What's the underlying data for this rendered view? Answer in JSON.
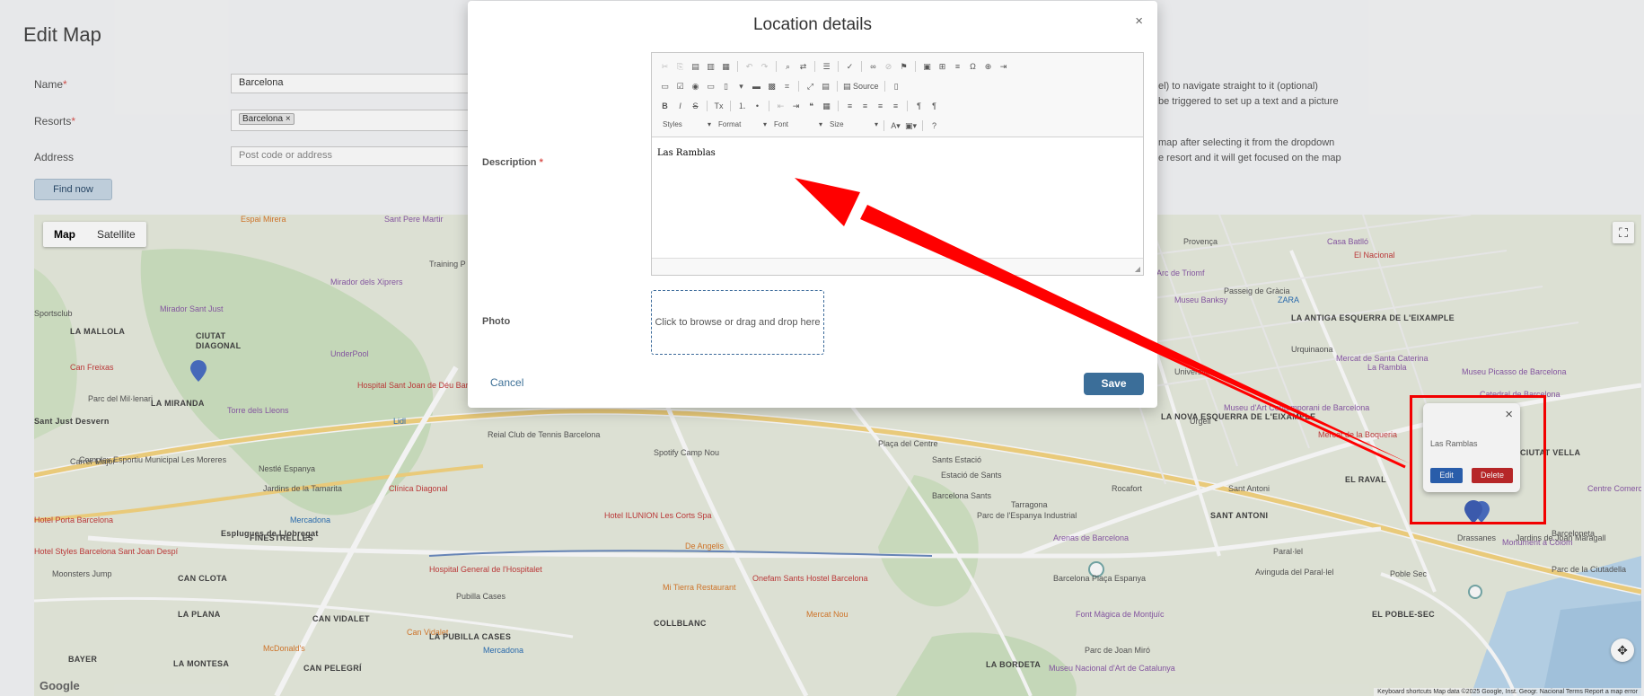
{
  "page": {
    "title": "Edit Map",
    "find_now": "Find now"
  },
  "form": {
    "name_label": "Name",
    "name_value": "Barcelona",
    "resorts_label": "Resorts",
    "resort_tag": "Barcelona",
    "resort_tag_remove": "×",
    "address_label": "Address",
    "address_placeholder": "Post code or address",
    "required_mark": "*"
  },
  "help": {
    "line1": "el) to navigate straight to it (optional)",
    "line2": "be triggered to set up a text and a picture",
    "line3": "map after selecting it from the dropdown",
    "line4": "e resort and it will get focused on the map"
  },
  "map": {
    "map_tab": "Map",
    "satellite_tab": "Satellite",
    "google": "Google",
    "attribution": "Keyboard shortcuts   Map data ©2025 Google, Inst. Geogr. Nacional   Terms   Report a map error",
    "labels": [
      {
        "text": "Espai Mirera",
        "c": "orange"
      },
      {
        "text": "Sant Pere Martir",
        "c": "poi"
      },
      {
        "text": "Mirador dels Xiprers",
        "c": "poi"
      },
      {
        "text": "Training P",
        "c": ""
      },
      {
        "text": "Mirador Sant Just",
        "c": "poi"
      },
      {
        "text": "CIUTAT",
        "c": "b"
      },
      {
        "text": "DIAGONAL",
        "c": "b"
      },
      {
        "text": "LA MALLOLA",
        "c": "b"
      },
      {
        "text": "Sportsclub",
        "c": ""
      },
      {
        "text": "UnderPool",
        "c": "poi"
      },
      {
        "text": "Can Freixas",
        "c": "red"
      },
      {
        "text": "Hospital Sant Joan de Déu Barcelona",
        "c": "red"
      },
      {
        "text": "LA MIRANDA",
        "c": "b"
      },
      {
        "text": "Torre dels Lleons",
        "c": "poi"
      },
      {
        "text": "Parc del Mil·lenari",
        "c": ""
      },
      {
        "text": "Sant Just Desvern",
        "c": "b"
      },
      {
        "text": "Lidl",
        "c": "blue"
      },
      {
        "text": "Carrer Major",
        "c": ""
      },
      {
        "text": "Complex Esportiu Municipal Les Moreres",
        "c": ""
      },
      {
        "text": "Nestlé Espanya",
        "c": ""
      },
      {
        "text": "Jardins de la Tamarita",
        "c": ""
      },
      {
        "text": "Clínica Diagonal",
        "c": "red"
      },
      {
        "text": "Mercadona",
        "c": "blue"
      },
      {
        "text": "Hotel Porta Barcelona",
        "c": "red"
      },
      {
        "text": "Esplugues de Llobregat",
        "c": "b"
      },
      {
        "text": "FINESTRELLES",
        "c": "b"
      },
      {
        "text": "Hotel Styles Barcelona Sant Joan Despí",
        "c": "red"
      },
      {
        "text": "Moonsters Jump",
        "c": ""
      },
      {
        "text": "CAN CLOTA",
        "c": "b"
      },
      {
        "text": "Hospital General de l'Hospitalet",
        "c": "red"
      },
      {
        "text": "LA PLANA",
        "c": "b"
      },
      {
        "text": "CAN VIDALET",
        "c": "b"
      },
      {
        "text": "Can Vidalet",
        "c": "orange"
      },
      {
        "text": "Pubilla Cases",
        "c": ""
      },
      {
        "text": "LA PUBILLA CASES",
        "c": "b"
      },
      {
        "text": "BAYER",
        "c": "b"
      },
      {
        "text": "LA MONTESA",
        "c": "b"
      },
      {
        "text": "McDonald's",
        "c": "orange"
      },
      {
        "text": "CAN PELEGRÍ",
        "c": "b"
      },
      {
        "text": "Mercadona",
        "c": "blue"
      },
      {
        "text": "Reial Club de Tennis Barcelona",
        "c": ""
      },
      {
        "text": "Hotel ILUNION Les Corts Spa",
        "c": "red"
      },
      {
        "text": "De Angelis",
        "c": "orange"
      },
      {
        "text": "Spotify Camp Nou",
        "c": ""
      },
      {
        "text": "Mi Tierra Restaurant",
        "c": "orange"
      },
      {
        "text": "Onefam Sants Hostel Barcelona",
        "c": "red"
      },
      {
        "text": "COLLBLANC",
        "c": "b"
      },
      {
        "text": "Mercat Nou",
        "c": "orange"
      },
      {
        "text": "Plaça del Centre",
        "c": ""
      },
      {
        "text": "Sants Estació",
        "c": ""
      },
      {
        "text": "Barcelona Sants",
        "c": ""
      },
      {
        "text": "Estació de Sants",
        "c": ""
      },
      {
        "text": "Parc de l'Espanya Industrial",
        "c": ""
      },
      {
        "text": "Tarragona",
        "c": ""
      },
      {
        "text": "Arenas de Barcelona",
        "c": "poi"
      },
      {
        "text": "Barcelona Plaça Espanya",
        "c": ""
      },
      {
        "text": "Font Màgica de Montjuïc",
        "c": "poi"
      },
      {
        "text": "Parc de Joan Miró",
        "c": ""
      },
      {
        "text": "Rocafort",
        "c": ""
      },
      {
        "text": "LA BORDETA",
        "c": "b"
      },
      {
        "text": "Museu Nacional d'Art de Catalunya",
        "c": "poi"
      },
      {
        "text": "Barcelona",
        "c": "poi"
      },
      {
        "text": "Provença",
        "c": ""
      },
      {
        "text": "Casa Batlló",
        "c": "poi"
      },
      {
        "text": "El Nacional",
        "c": "red"
      },
      {
        "text": "Arc de Triomf",
        "c": "poi"
      },
      {
        "text": "Passeig de Gràcia",
        "c": ""
      },
      {
        "text": "ZARA",
        "c": "blue"
      },
      {
        "text": "Museu Banksy",
        "c": "poi"
      },
      {
        "text": "LA ANTIGA ESQUERRA DE L'EIXAMPLE",
        "c": "b"
      },
      {
        "text": "Urquinaona",
        "c": ""
      },
      {
        "text": "Mercat de Santa Caterina",
        "c": "poi"
      },
      {
        "text": "La Rambla",
        "c": "poi"
      },
      {
        "text": "Universitat",
        "c": ""
      },
      {
        "text": "Museu Picasso de Barcelona",
        "c": "poi"
      },
      {
        "text": "Urgell",
        "c": ""
      },
      {
        "text": "Museu d'Art Contemporani de Barcelona",
        "c": "poi"
      },
      {
        "text": "Mercat de la Boqueria",
        "c": "red"
      },
      {
        "text": "Catedral de Barcelona",
        "c": "poi"
      },
      {
        "text": "LA NOVA ESQUERRA DE L'EIXAMPLE",
        "c": "b"
      },
      {
        "text": "Sant Antoni",
        "c": ""
      },
      {
        "text": "EL RAVAL",
        "c": "b"
      },
      {
        "text": "SANT ANTONI",
        "c": "b"
      },
      {
        "text": "Drassanes",
        "c": ""
      },
      {
        "text": "Monument a Colom",
        "c": "poi"
      },
      {
        "text": "Poble Sec",
        "c": ""
      },
      {
        "text": "EL POBLE-SEC",
        "c": "b"
      },
      {
        "text": "Barceloneta",
        "c": ""
      },
      {
        "text": "CIUTAT VELLA",
        "c": "b"
      },
      {
        "text": "Centre Comercial Maremagnum",
        "c": "poi"
      },
      {
        "text": "Parc de la Ciutadella",
        "c": ""
      },
      {
        "text": "Jardins de Joan Maragall",
        "c": ""
      },
      {
        "text": "Avinguda del Paral·lel",
        "c": ""
      },
      {
        "text": "Paral·lel",
        "c": ""
      }
    ],
    "infowindow": {
      "close": "×",
      "text": "Las Ramblas",
      "edit": "Edit",
      "delete": "Delete"
    }
  },
  "modal": {
    "title": "Location details",
    "close": "×",
    "description_label": "Description",
    "required_mark": "*",
    "toolbar": {
      "styles": "Styles",
      "format": "Format",
      "font": "Font",
      "size": "Size",
      "source": "Source"
    },
    "content": "Las Ramblas",
    "photo_label": "Photo",
    "dropzone_text": "Click to browse or drag and drop here",
    "cancel": "Cancel",
    "save": "Save"
  }
}
